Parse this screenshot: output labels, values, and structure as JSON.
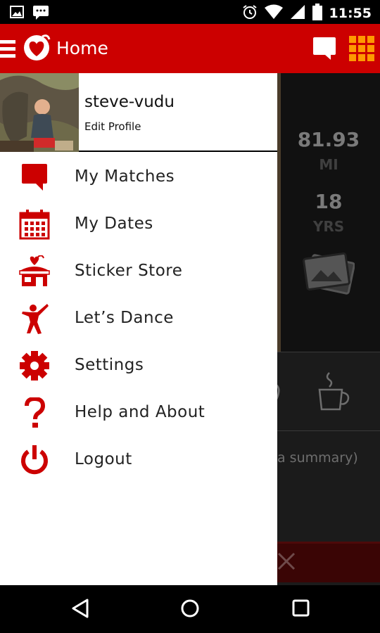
{
  "status_bar": {
    "time": "11:55",
    "left_icons": [
      "image-notification-icon",
      "messenger-notification-icon"
    ],
    "right_icons": [
      "alarm-icon",
      "wifi-icon",
      "signal-icon",
      "battery-icon"
    ]
  },
  "app_bar": {
    "title": "Home",
    "accent_color": "#cc0000",
    "grid_color": "#ff9900"
  },
  "profile": {
    "username": "steve-vudu",
    "edit_label": "Edit Profile"
  },
  "menu": {
    "items": [
      {
        "label": "My Matches",
        "icon": "chat-bubble-icon"
      },
      {
        "label": "My Dates",
        "icon": "calendar-icon"
      },
      {
        "label": "Sticker Store",
        "icon": "store-icon"
      },
      {
        "label": "Let’s Dance",
        "icon": "dancer-icon"
      },
      {
        "label": "Settings",
        "icon": "gear-icon"
      },
      {
        "label": "Help and About",
        "icon": "question-icon"
      },
      {
        "label": "Logout",
        "icon": "power-icon"
      }
    ]
  },
  "background_page": {
    "distance_value": "81.93",
    "distance_unit": "MI",
    "age_value": "18",
    "age_unit": "YRS",
    "summary_text": "a summary)"
  },
  "nav_bar": {
    "buttons": [
      "back-icon",
      "home-icon",
      "recents-icon"
    ]
  }
}
